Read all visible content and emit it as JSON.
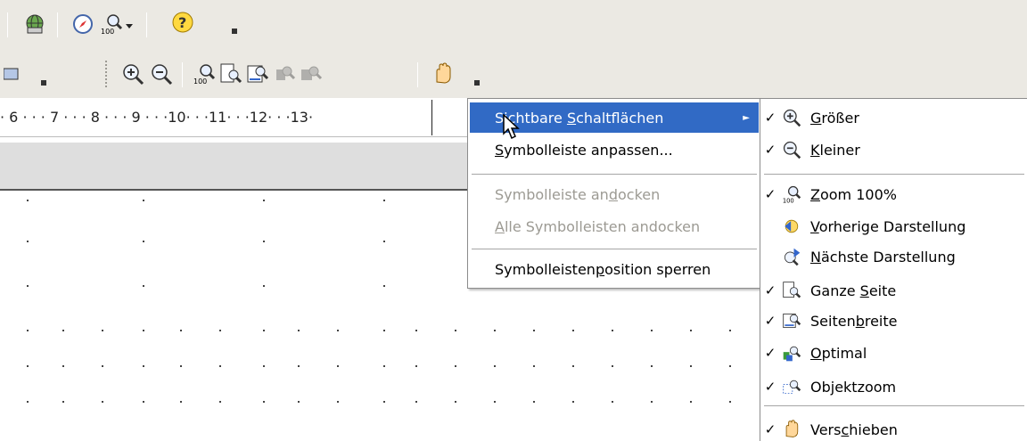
{
  "ruler": {
    "text": "· 6 · · · 7 · · · 8 · · · 9 · · ·10· · ·11· · ·12· · ·13·"
  },
  "toolbar1": {
    "icons": [
      "navigator-icon",
      "zoom-100-icon",
      "help-icon"
    ]
  },
  "toolbar2": {
    "icons": [
      "zoom-in-icon",
      "zoom-out-icon",
      "zoom-100-icon",
      "whole-page-icon",
      "page-width-icon",
      "optimal-icon",
      "object-zoom-icon",
      "pan-icon"
    ]
  },
  "context_menu": {
    "items": [
      {
        "label": "Sichtbare Schaltflächen",
        "accel_prefix": "Sichtbare ",
        "accel_char": "S",
        "accel_suffix": "chaltflächen",
        "state": "selected",
        "has_submenu": true
      },
      {
        "label": "Symbolleiste anpassen...",
        "accel_prefix": "",
        "accel_char": "S",
        "accel_suffix": "ymbolleiste anpassen...",
        "state": "normal"
      },
      {
        "label": "Symbolleiste andocken",
        "accel_prefix": "Symbolleiste an",
        "accel_char": "d",
        "accel_suffix": "ocken",
        "state": "disabled"
      },
      {
        "label": "Alle Symbolleisten andocken",
        "accel_prefix": "",
        "accel_char": "A",
        "accel_suffix": "lle Symbolleisten andocken",
        "state": "disabled"
      },
      {
        "label": "Symbolleistenposition sperren",
        "accel_prefix": "Symbolleisten",
        "accel_char": "p",
        "accel_suffix": "osition sperren",
        "state": "normal"
      }
    ]
  },
  "submenu": {
    "items": [
      {
        "label": "Größer",
        "accel_prefix": "",
        "accel_char": "G",
        "accel_suffix": "rößer",
        "checked": true,
        "icon": "zoom-in-icon"
      },
      {
        "label": "Kleiner",
        "accel_prefix": "",
        "accel_char": "K",
        "accel_suffix": "leiner",
        "checked": true,
        "icon": "zoom-out-icon"
      },
      {
        "label": "Zoom 100%",
        "accel_prefix": "",
        "accel_char": "Z",
        "accel_suffix": "oom 100%",
        "checked": true,
        "icon": "zoom-100-icon"
      },
      {
        "label": "Vorherige Darstellung",
        "accel_prefix": "",
        "accel_char": "V",
        "accel_suffix": "orherige Darstellung",
        "checked": false,
        "icon": "previous-view-icon"
      },
      {
        "label": "Nächste Darstellung",
        "accel_prefix": "",
        "accel_char": "N",
        "accel_suffix": "ächste Darstellung",
        "checked": false,
        "icon": "next-view-icon"
      },
      {
        "label": "Ganze Seite",
        "accel_prefix": "Ganze ",
        "accel_char": "S",
        "accel_suffix": "eite",
        "checked": true,
        "icon": "whole-page-icon"
      },
      {
        "label": "Seitenbreite",
        "accel_prefix": "Seiten",
        "accel_char": "b",
        "accel_suffix": "reite",
        "checked": true,
        "icon": "page-width-icon"
      },
      {
        "label": "Optimal",
        "accel_prefix": "",
        "accel_char": "O",
        "accel_suffix": "ptimal",
        "checked": true,
        "icon": "optimal-icon"
      },
      {
        "label": "Objektzoom",
        "accel_prefix": "Objektzoom",
        "accel_char": "",
        "accel_suffix": "",
        "checked": true,
        "icon": "object-zoom-icon"
      },
      {
        "label": "Verschieben",
        "accel_prefix": "Vers",
        "accel_char": "c",
        "accel_suffix": "hieben",
        "checked": true,
        "icon": "pan-icon"
      }
    ]
  },
  "colors": {
    "toolbar_bg": "#ebe9e3",
    "menu_highlight": "#316ac5",
    "disabled_text": "#9c9a93"
  }
}
